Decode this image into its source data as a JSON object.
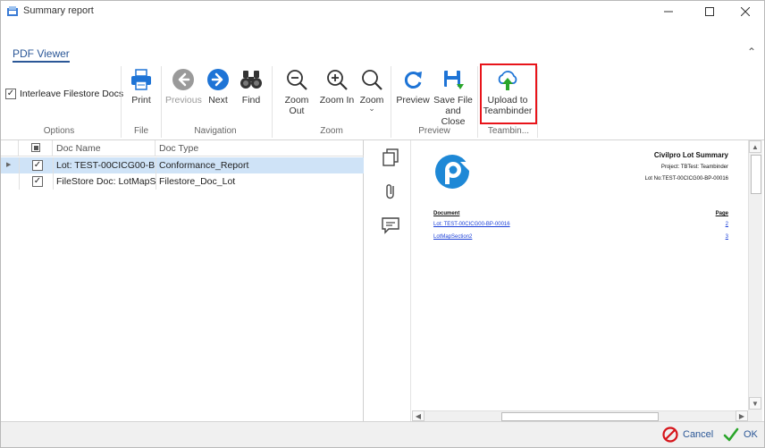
{
  "window": {
    "title": "Summary report",
    "minimize_icon": "minimize-icon",
    "maximize_icon": "maximize-icon",
    "close_icon": "close-icon"
  },
  "ribbon": {
    "tab": "PDF Viewer",
    "groups": {
      "options": "Options",
      "file": "File",
      "navigation": "Navigation",
      "zoom": "Zoom",
      "preview": "Preview",
      "teambinder": "Teambin..."
    },
    "options": {
      "interleave_label": "Interleave Filestore Docs",
      "interleave_checked": true
    },
    "buttons": {
      "print": "Print",
      "previous": "Previous",
      "next": "Next",
      "find": "Find",
      "zoom_out": "Zoom Out",
      "zoom_in": "Zoom In",
      "zoom": "Zoom",
      "zoom_dropdown": "⌄",
      "preview": "Preview",
      "save_line1": "Save File",
      "save_line2": "and Close",
      "upload_line1": "Upload to",
      "upload_line2": "Teambinder"
    },
    "collapse_glyph": "⌃",
    "colors": {
      "accent": "#2b5797",
      "next_blue": "#1e74d6",
      "upload_green": "#2aa52a",
      "highlight": "#e8141a"
    }
  },
  "grid": {
    "columns": [
      "Doc Name",
      "Doc Type"
    ],
    "rows": [
      {
        "checked": true,
        "doc_name": "Lot: TEST-00CICG00-B...",
        "doc_type": "Conformance_Report",
        "selected": true
      },
      {
        "checked": true,
        "doc_name": "FileStore Doc: LotMapS...",
        "doc_type": "Filestore_Doc_Lot",
        "selected": false
      }
    ]
  },
  "pdf": {
    "title": "Civilpro Lot Summary",
    "project": "Project: TBTest: Teambinder",
    "lot_no": "Lot No:TEST-00CICG00-BP-00016",
    "document_header": "Document",
    "page_header": "Page",
    "entries": [
      {
        "document": "Lot: TEST-00CICG00-BP-00016",
        "page": "2"
      },
      {
        "document": "LotMapSection2",
        "page": "3"
      }
    ]
  },
  "footer": {
    "cancel": "Cancel",
    "ok": "OK"
  }
}
